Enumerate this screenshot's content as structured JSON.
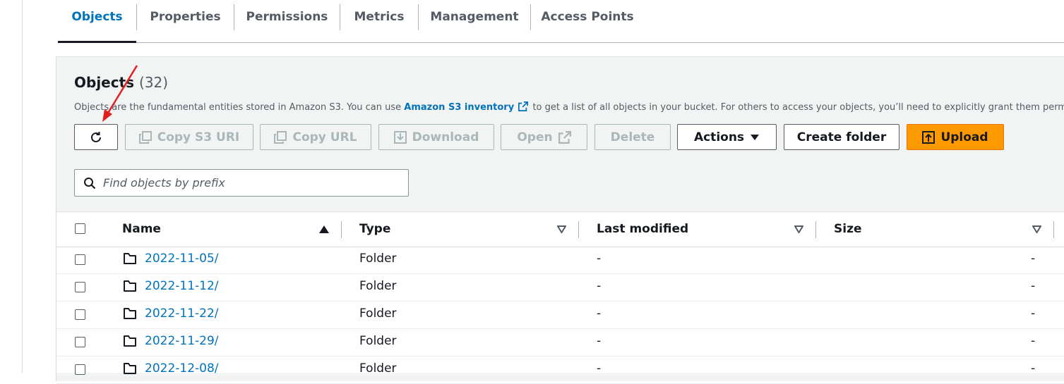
{
  "tabs": [
    {
      "label": "Objects",
      "active": true
    },
    {
      "label": "Properties"
    },
    {
      "label": "Permissions"
    },
    {
      "label": "Metrics"
    },
    {
      "label": "Management"
    },
    {
      "label": "Access Points"
    }
  ],
  "objects": {
    "title": "Objects",
    "count": "(32)",
    "desc_before": "Objects are the fundamental entities stored in Amazon S3. You can use ",
    "desc_link": "Amazon S3 inventory",
    "desc_after": " to get a list of all objects in your bucket. For others to access your objects, you’ll need to explicitly grant them permissions."
  },
  "toolbar": {
    "refresh_icon": "refresh-icon",
    "copy_s3_uri": "Copy S3 URI",
    "copy_url": "Copy URL",
    "download": "Download",
    "open": "Open",
    "delete": "Delete",
    "actions": "Actions",
    "create_folder": "Create folder",
    "upload": "Upload"
  },
  "search": {
    "placeholder": "Find objects by prefix"
  },
  "table": {
    "columns": [
      "Name",
      "Type",
      "Last modified",
      "Size"
    ],
    "rows": [
      {
        "name": "2022-11-05/",
        "type": "Folder",
        "last_modified": "-",
        "size": "-"
      },
      {
        "name": "2022-11-12/",
        "type": "Folder",
        "last_modified": "-",
        "size": "-"
      },
      {
        "name": "2022-11-22/",
        "type": "Folder",
        "last_modified": "-",
        "size": "-"
      },
      {
        "name": "2022-11-29/",
        "type": "Folder",
        "last_modified": "-",
        "size": "-"
      },
      {
        "name": "2022-12-08/",
        "type": "Folder",
        "last_modified": "-",
        "size": "-"
      }
    ]
  },
  "colors": {
    "accent": "#0073bb",
    "upload": "#ff9900",
    "annotation": "#e0201f"
  }
}
